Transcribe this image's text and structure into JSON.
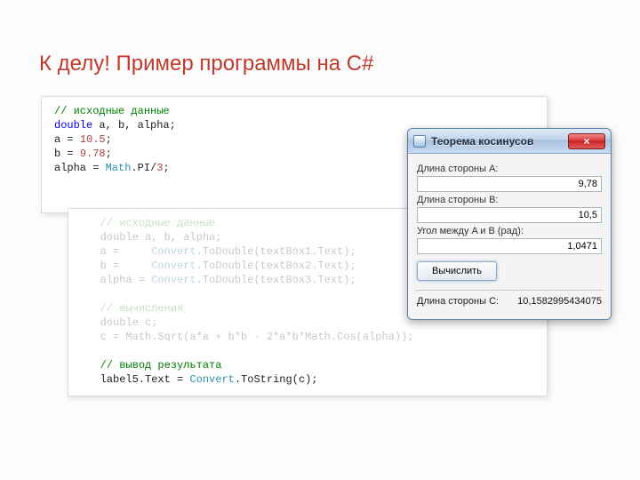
{
  "slide": {
    "title": "К делу! Пример программы на C#"
  },
  "code1": {
    "c1": "// исходные данные",
    "l2a": "double",
    "l2b": " a, b, alpha;",
    "l3a": "a = ",
    "l3b": "10.5",
    "l3c": ";",
    "l4a": "b = ",
    "l4b": "9.78",
    "l4c": ";",
    "l5a": "alpha = ",
    "l5b": "Math",
    "l5c": ".PI/",
    "l5d": "3",
    "l5e": ";"
  },
  "code2": {
    "pad": "   ",
    "c1": "// исходные данные",
    "l2": "double a, b, alpha;",
    "l3a": "a =     ",
    "l3b": "Convert",
    "l3c": ".ToDouble(textBox1.Text);",
    "l4a": "b =     ",
    "l4b": "Convert",
    "l4c": ".ToDouble(textBox2.Text);",
    "l5a": "alpha = ",
    "l5b": "Convert",
    "l5c": ".ToDouble(textBox3.Text);",
    "c2": "// вычисления",
    "l7": "double c;",
    "l8": "c = Math.Sqrt(a*a + b*b - 2*a*b*Math.Cos(alpha));",
    "c3": "// вывод результата",
    "l10a": "label5.Text = ",
    "l10b": "Convert",
    "l10c": ".ToString(c);"
  },
  "dialog": {
    "title": "Теорема косинусов",
    "close_glyph": "×",
    "lblA": "Длина стороны A:",
    "valA": "9,78",
    "lblB": "Длина стороны B:",
    "valB": "10,5",
    "lblAngle": "Угол между A и B (рад):",
    "valAngle": "1,0471",
    "compute": "Вычислить",
    "lblC": "Длина стороны C:",
    "valC": "10,1582995434075"
  }
}
